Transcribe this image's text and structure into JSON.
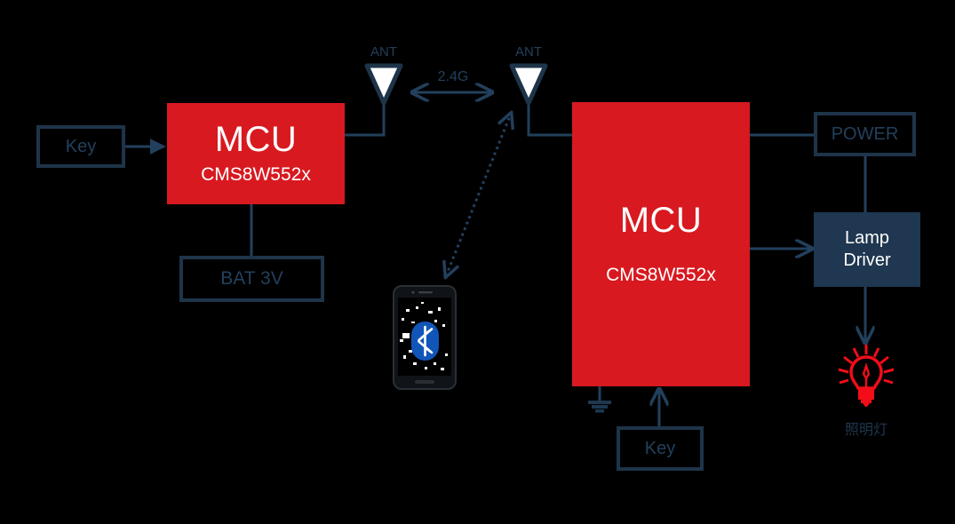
{
  "diagram": {
    "title_text": "",
    "colors": {
      "background": "#000000",
      "mcu_red": "#d81920",
      "navy": "#1f3750",
      "outline": "#1e3449",
      "wire": "#22405c",
      "bluetooth_blue": "#1155b8",
      "lamp_red": "#f20d19"
    },
    "blocks": {
      "key_left": {
        "label": "Key"
      },
      "bat": {
        "label": "BAT 3V"
      },
      "mcu_left": {
        "title": "MCU",
        "part": "CMS8W552x"
      },
      "mcu_right": {
        "title": "MCU",
        "part": "CMS8W552x"
      },
      "power": {
        "label": "POWER"
      },
      "lamp_driver": {
        "line1": "Lamp",
        "line2": "Driver"
      },
      "key_right": {
        "label": "Key"
      }
    },
    "antennas": {
      "left": {
        "label": "ANT"
      },
      "right": {
        "label": "ANT"
      }
    },
    "links": {
      "rf_label": "2.4G"
    },
    "lamp": {
      "caption": "照明灯",
      "icon_name": "light-bulb-icon"
    },
    "phone": {
      "icon_name": "bluetooth-icon"
    },
    "ground": {
      "icon_name": "ground-symbol-icon"
    }
  }
}
